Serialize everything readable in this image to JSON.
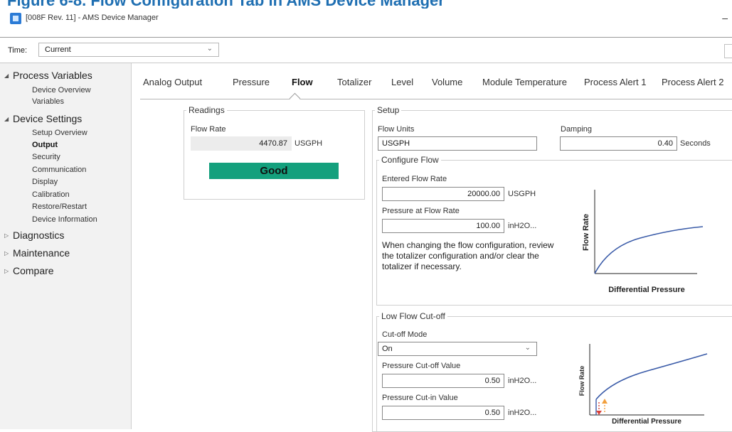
{
  "banner": {
    "text": "Figure 6-8. Flow Configuration Tab in AMS Device Manager"
  },
  "window": {
    "title": "[008F Rev. 11] - AMS Device Manager",
    "min_glyph": "–"
  },
  "time": {
    "label": "Time:",
    "value": "Current",
    "chev": "⌄"
  },
  "sidebar": {
    "groups": [
      {
        "label": "Process Variables",
        "glyph": "◢",
        "children": [
          "Device Overview",
          "Variables"
        ]
      },
      {
        "label": "Device Settings",
        "glyph": "◢",
        "children": [
          "Setup Overview",
          "Output",
          "Security",
          "Communication",
          "Display",
          "Calibration",
          "Restore/Restart",
          "Device Information"
        ]
      },
      {
        "label": "Diagnostics",
        "glyph": "▷"
      },
      {
        "label": "Maintenance",
        "glyph": "▷"
      },
      {
        "label": "Compare",
        "glyph": "▷"
      }
    ],
    "active_item": "Output"
  },
  "tabs": [
    "Analog Output",
    "Pressure",
    "Flow",
    "Totalizer",
    "Level",
    "Volume",
    "Module Temperature",
    "Process Alert 1",
    "Process Alert 2"
  ],
  "active_tab": "Flow",
  "readings": {
    "legend": "Readings",
    "flow_rate_label": "Flow Rate",
    "flow_rate_value": "4470.87",
    "flow_rate_unit": "USGPH",
    "status": "Good"
  },
  "setup": {
    "legend": "Setup",
    "flow_units_label": "Flow Units",
    "flow_units_value": "USGPH",
    "damping_label": "Damping",
    "damping_value": "0.40",
    "damping_unit": "Seconds"
  },
  "configure_flow": {
    "legend": "Configure Flow",
    "entered_label": "Entered Flow Rate",
    "entered_value": "20000.00",
    "entered_unit": "USGPH",
    "pressure_label": "Pressure at Flow Rate",
    "pressure_value": "100.00",
    "pressure_unit": "inH2O...",
    "note": "When changing the flow configuration, review the totalizer configuration and/or clear the totalizer if necessary.",
    "graph": {
      "ylabel": "Flow Rate",
      "xlabel": "Differential Pressure"
    }
  },
  "low_flow": {
    "legend": "Low Flow Cut-off",
    "mode_label": "Cut-off Mode",
    "mode_value": "On",
    "chev": "⌄",
    "cutoff_label": "Pressure Cut-off Value",
    "cutoff_value": "0.50",
    "cutoff_unit": "inH2O...",
    "cutin_label": "Pressure Cut-in Value",
    "cutin_value": "0.50",
    "cutin_unit": "inH2O...",
    "graph": {
      "ylabel": "Flow Rate",
      "xlabel": "Differential Pressure"
    }
  },
  "colors": {
    "accent": "#1f6fb2",
    "status_good": "#14a07d",
    "curve": "#3a5ba8",
    "arrow_down": "#d9413a",
    "arrow_up": "#f2a03d"
  }
}
